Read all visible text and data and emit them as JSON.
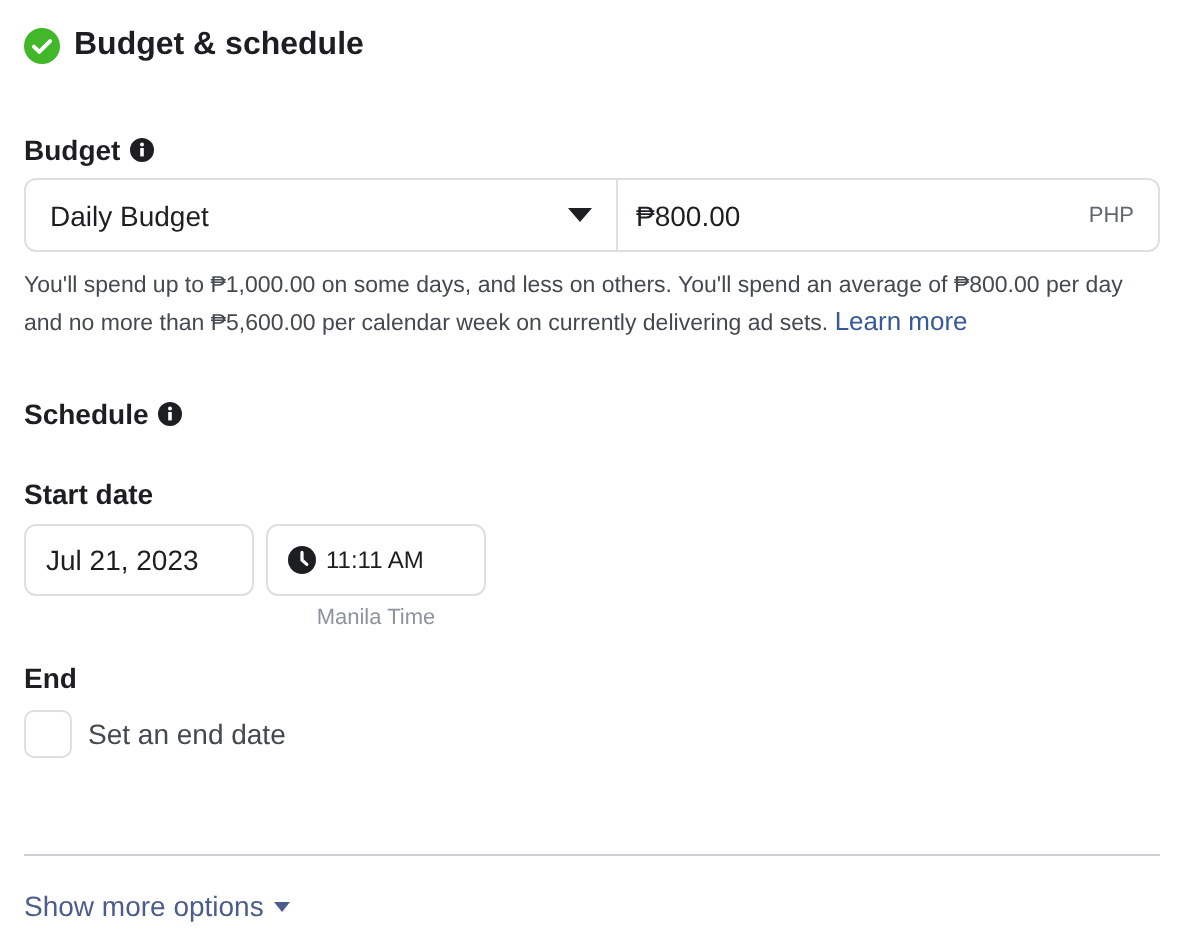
{
  "section": {
    "title": "Budget & schedule",
    "complete": true
  },
  "budget": {
    "label": "Budget",
    "type_dropdown": {
      "value": "Daily Budget"
    },
    "amount": {
      "value": "₱800.00",
      "currency": "PHP"
    },
    "help_text": "You'll spend up to ₱1,000.00 on some days, and less on others. You'll spend an average of ₱800.00 per day and no more than ₱5,600.00 per calendar week on currently delivering ad sets.",
    "help_link": "Learn more"
  },
  "schedule": {
    "label": "Schedule",
    "start_date": {
      "label": "Start date",
      "date": "Jul 21, 2023",
      "time": "11:11 AM",
      "timezone": "Manila Time"
    },
    "end": {
      "label": "End",
      "checkbox": {
        "label": "Set an end date",
        "checked": false
      }
    }
  },
  "show_more": "Show more options"
}
